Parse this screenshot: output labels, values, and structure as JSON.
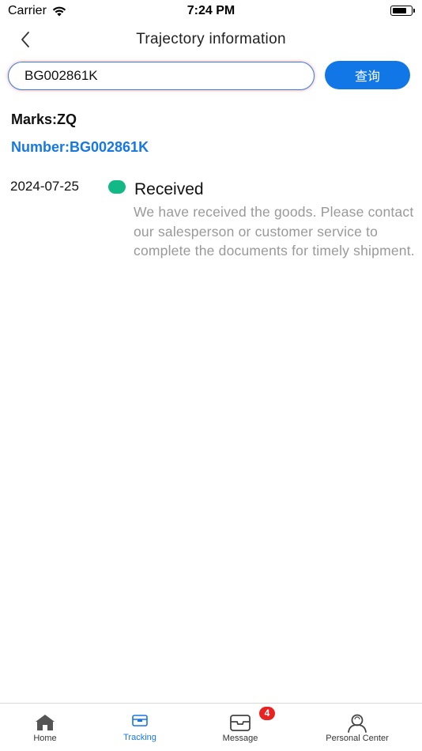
{
  "status_bar": {
    "carrier": "Carrier",
    "time": "7:24 PM"
  },
  "nav": {
    "title": "Trajectory information",
    "back_icon": "chevron-left-icon"
  },
  "search": {
    "value": "BG002861K",
    "button_label": "查询"
  },
  "info": {
    "marks": "Marks:ZQ",
    "number": "Number:BG002861K"
  },
  "timeline": [
    {
      "date": "2024-07-25",
      "status": "Received",
      "description": "We have received the goods. Please contact our salesperson or customer service to complete the documents for timely shipment.",
      "dot_color": "#12b886"
    }
  ],
  "tab_bar": {
    "items": [
      {
        "label": "Home",
        "icon": "home-icon",
        "active": false
      },
      {
        "label": "Tracking",
        "icon": "package-icon",
        "active": true
      },
      {
        "label": "Message",
        "icon": "inbox-icon",
        "active": false,
        "badge": "4"
      },
      {
        "label": "Personal Center",
        "icon": "user-icon",
        "active": false
      }
    ]
  },
  "colors": {
    "accent": "#1677e6",
    "button": "#1277e6",
    "status_green": "#12b886",
    "badge": "#e82121",
    "muted_text": "#999999"
  }
}
